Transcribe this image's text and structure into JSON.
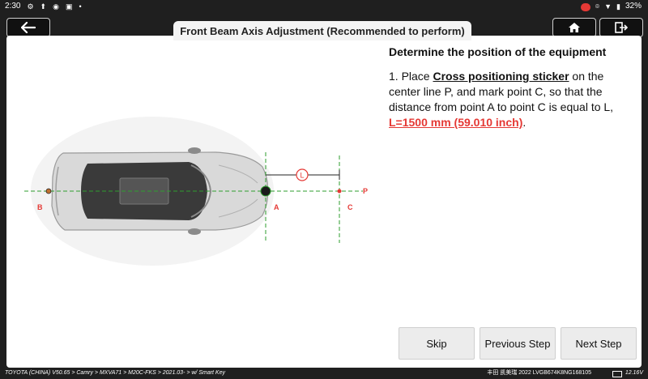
{
  "status_bar": {
    "time": "2:30",
    "battery": "32%"
  },
  "header": {
    "title": "Front Beam Axis Adjustment (Recommended to perform)",
    "back_icon": "back-arrow-icon",
    "home_icon": "home-icon",
    "exit_icon": "exit-icon"
  },
  "instructions": {
    "heading": "Determine the position of the equipment",
    "step_prefix": "1. Place ",
    "sticker_label": "Cross positioning sticker",
    "step_body": " on the center line P, and mark point C, so that the distance from point A to point C is equal to L,",
    "distance_value": "L=1500 mm (59.010 inch)",
    "distance_suffix": "."
  },
  "diagram": {
    "label_a": "A",
    "label_b": "B",
    "label_c": "C",
    "label_p": "P",
    "label_l": "L",
    "line_color": "#2e9e2e",
    "marker_color": "#e53935"
  },
  "buttons": {
    "skip": "Skip",
    "previous": "Previous Step",
    "next": "Next Step"
  },
  "footer": {
    "breadcrumb": "TOYOTA (CHINA) V50.65 > Camry > MXVA71 > M20C-FKS > 2021.03- > w/ Smart Key",
    "vehicle": "丰田 凯美瑞 2022  LVGB674K8NG168105",
    "voltage": "12.16V"
  }
}
